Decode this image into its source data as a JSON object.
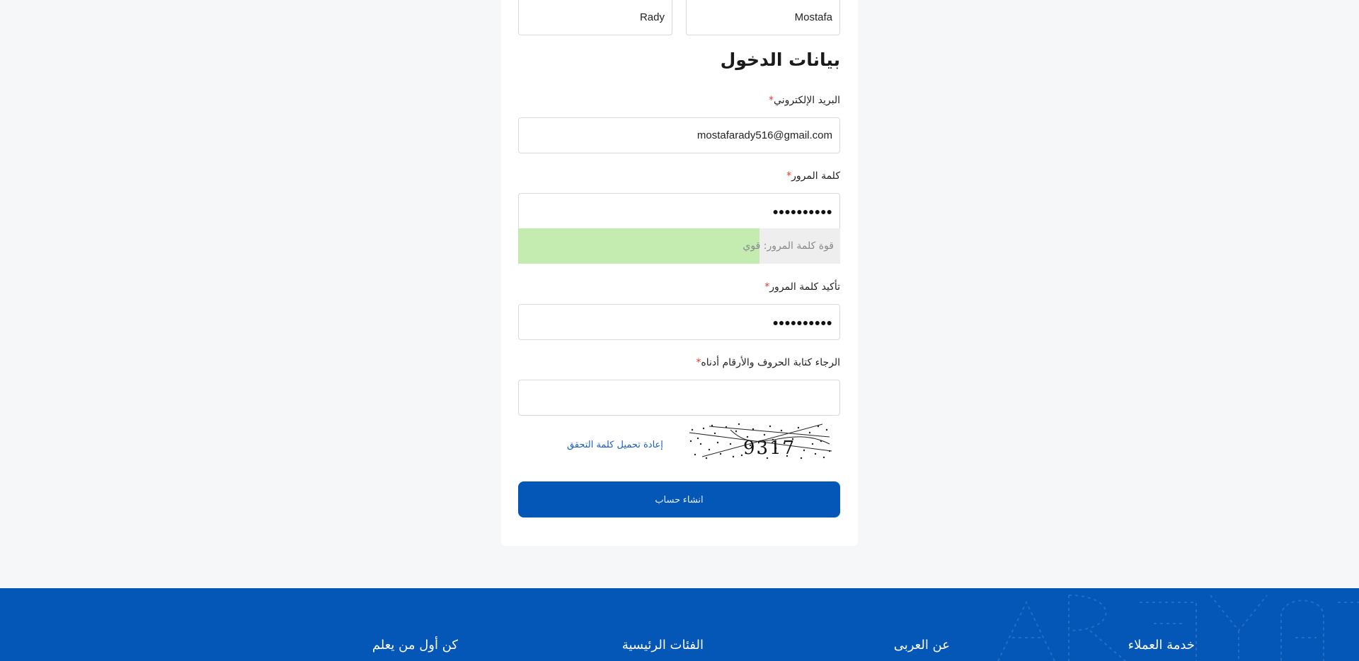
{
  "name_fields": {
    "first_name_value": "Mostafa",
    "last_name_value": "Rady"
  },
  "login_section": {
    "title": "بيانات الدخول",
    "email_label": "البريد الإلكتروني",
    "email_value": "mostafarady516@gmail.com",
    "password_label": "كلمة المرور",
    "password_value": "●●●●●●●●●●",
    "strength_text": "قوة كلمة المرور: قوي",
    "strength_level": 0.75,
    "confirm_password_label": "تأكيد كلمة المرور",
    "confirm_password_value": "●●●●●●●●●●",
    "captcha_label": "الرجاء كتابة الحروف والأرقام أدناه",
    "captcha_value": "",
    "captcha_text": "9317",
    "reload_captcha_label": "إعادة تحميل كلمة التحقق",
    "required_mark": "*"
  },
  "submit_label": "انشاء حساب",
  "footer": {
    "headings": [
      "خدمة العملاء",
      "عن العربى",
      "الفئات الرئيسية",
      "كن أول من يعلم"
    ]
  },
  "colors": {
    "primary": "#0557b7",
    "strength_fill": "#c5ecb0",
    "required": "#e53935",
    "link": "#1b5fba"
  }
}
